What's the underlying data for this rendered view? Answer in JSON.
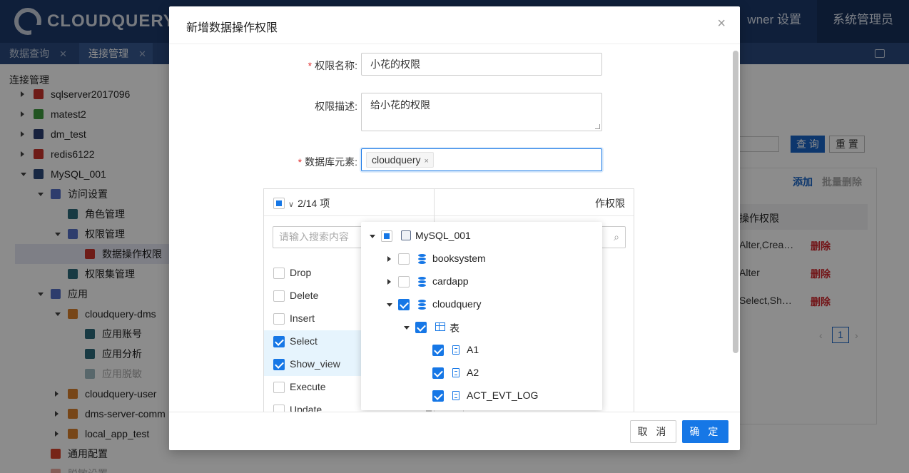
{
  "app": {
    "logo_text": "CLOUDQUERY",
    "top_nav": [
      {
        "label": "wner 设置",
        "active": false
      },
      {
        "label": "系统管理员",
        "active": true
      }
    ],
    "tabs": [
      {
        "label": "数据查询",
        "active": false
      },
      {
        "label": "连接管理",
        "active": true
      }
    ]
  },
  "sidebar": {
    "title": "连接管理",
    "items": [
      {
        "label": "sqlserver2017096",
        "level": 0,
        "caret": "right",
        "icon": "sqlserver-icon"
      },
      {
        "label": "matest2",
        "level": 0,
        "caret": "right",
        "icon": "mongodb-icon"
      },
      {
        "label": "dm_test",
        "level": 0,
        "caret": "right",
        "icon": "dm-icon"
      },
      {
        "label": "redis6122",
        "level": 0,
        "caret": "right",
        "icon": "redis-icon"
      },
      {
        "label": "MySQL_001",
        "level": 0,
        "caret": "down",
        "icon": "mysql-icon"
      },
      {
        "label": "访问设置",
        "level": 1,
        "caret": "down",
        "icon": "list-icon"
      },
      {
        "label": "角色管理",
        "level": 2,
        "caret": "none",
        "icon": "users-icon"
      },
      {
        "label": "权限管理",
        "level": 2,
        "caret": "down",
        "icon": "list-icon"
      },
      {
        "label": "数据操作权限",
        "level": 3,
        "caret": "none",
        "icon": "db-perm-icon",
        "selected": true
      },
      {
        "label": "权限集管理",
        "level": 2,
        "caret": "none",
        "icon": "perm-set-icon"
      },
      {
        "label": "应用",
        "level": 1,
        "caret": "down",
        "icon": "list-icon"
      },
      {
        "label": "cloudquery-dms",
        "level": 2,
        "caret": "down",
        "icon": "cube-icon"
      },
      {
        "label": "应用账号",
        "level": 3,
        "caret": "none",
        "icon": "app-icon"
      },
      {
        "label": "应用分析",
        "level": 3,
        "caret": "none",
        "icon": "app-icon"
      },
      {
        "label": "应用脱敏",
        "level": 3,
        "caret": "none",
        "icon": "app-icon",
        "muted": true
      },
      {
        "label": "cloudquery-user",
        "level": 2,
        "caret": "right",
        "icon": "cube-icon"
      },
      {
        "label": "dms-server-comm",
        "level": 2,
        "caret": "right",
        "icon": "cube-icon"
      },
      {
        "label": "local_app_test",
        "level": 2,
        "caret": "right",
        "icon": "cube-icon"
      },
      {
        "label": "通用配置",
        "level": 1,
        "caret": "none",
        "icon": "gear-icon"
      },
      {
        "label": "脱敏设置",
        "level": 1,
        "caret": "none",
        "icon": "gear-icon",
        "muted": true
      }
    ]
  },
  "content": {
    "query_label": "查 询",
    "reset_label": "重 置",
    "add_label": "添加",
    "batch_delete_label": "批量删除",
    "column_perm": "操作权限",
    "rows": [
      {
        "perm": "Alter,Crea…",
        "action": "删除"
      },
      {
        "perm": "Alter",
        "action": "删除"
      },
      {
        "perm": "Select,Sh…",
        "action": "删除"
      }
    ],
    "page": "1"
  },
  "modal": {
    "title": "新增数据操作权限",
    "close_glyph": "×",
    "fields": {
      "name_label": "权限名称:",
      "name_value": "小花的权限",
      "desc_label": "权限描述:",
      "desc_value": "给小花的权限",
      "db_label": "数据库元素:",
      "db_tag": "cloudquery",
      "tag_close": "×"
    },
    "transfer": {
      "left_count": "2/14 项",
      "search_placeholder": "请输入搜索内容",
      "operations": [
        {
          "label": "Drop",
          "checked": false
        },
        {
          "label": "Delete",
          "checked": false
        },
        {
          "label": "Insert",
          "checked": false
        },
        {
          "label": "Select",
          "checked": true
        },
        {
          "label": "Show_view",
          "checked": true
        },
        {
          "label": "Execute",
          "checked": false
        },
        {
          "label": "Update",
          "checked": false
        }
      ],
      "right_title_partial": "作权限"
    },
    "tree": [
      {
        "label": "MySQL_001",
        "level": 0,
        "caret": "down",
        "check": "indeterminate",
        "icon": "mysql-icon"
      },
      {
        "label": "booksystem",
        "level": 1,
        "caret": "right",
        "check": "unchecked",
        "icon": "database-icon"
      },
      {
        "label": "cardapp",
        "level": 1,
        "caret": "right",
        "check": "unchecked",
        "icon": "database-icon"
      },
      {
        "label": "cloudquery",
        "level": 1,
        "caret": "down",
        "check": "checked",
        "icon": "database-icon"
      },
      {
        "label": "表",
        "level": 2,
        "caret": "down",
        "check": "checked",
        "icon": "table-icon"
      },
      {
        "label": "A1",
        "level": 3,
        "caret": "none",
        "check": "checked",
        "icon": "file-icon"
      },
      {
        "label": "A2",
        "level": 3,
        "caret": "none",
        "check": "checked",
        "icon": "file-icon"
      },
      {
        "label": "ACT_EVT_LOG",
        "level": 3,
        "caret": "none",
        "check": "checked",
        "icon": "file-icon"
      }
    ],
    "footer": {
      "cancel_label": "取 消",
      "ok_label": "确 定"
    }
  },
  "colors": {
    "topbar": "#1d3a6b",
    "primary": "#1677e6",
    "danger": "#d0262a"
  }
}
